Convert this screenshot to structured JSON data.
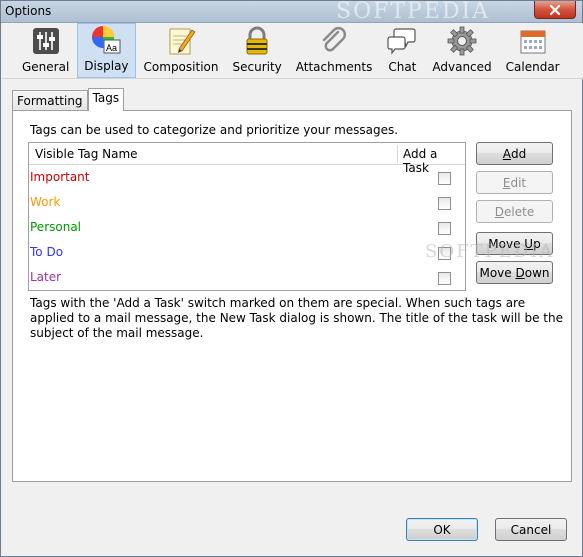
{
  "window": {
    "title": "Options",
    "watermark": "SOFTPEDIA"
  },
  "toolbar": {
    "items": [
      {
        "label": "General",
        "icon": "sliders-icon"
      },
      {
        "label": "Display",
        "icon": "color-wheel-icon"
      },
      {
        "label": "Composition",
        "icon": "notepad-pencil-icon"
      },
      {
        "label": "Security",
        "icon": "padlock-icon"
      },
      {
        "label": "Attachments",
        "icon": "paperclip-icon"
      },
      {
        "label": "Chat",
        "icon": "speech-bubbles-icon"
      },
      {
        "label": "Advanced",
        "icon": "gear-icon"
      },
      {
        "label": "Calendar",
        "icon": "calendar-icon"
      }
    ],
    "selected": "Display"
  },
  "tabs": [
    {
      "label": "Formatting",
      "active": false
    },
    {
      "label": "Tags",
      "active": true
    }
  ],
  "tags_panel": {
    "intro": "Tags can be used to categorize and prioritize your messages.",
    "columns": {
      "name": "Visible Tag Name",
      "task": "Add a Task"
    },
    "rows": [
      {
        "name": "Important",
        "color": "#cc0000",
        "checked": false
      },
      {
        "name": "Work",
        "color": "#ff9900",
        "checked": false
      },
      {
        "name": "Personal",
        "color": "#009900",
        "checked": false
      },
      {
        "name": "To Do",
        "color": "#3333ff",
        "checked": false
      },
      {
        "name": "Later",
        "color": "#993399",
        "checked": false
      }
    ],
    "buttons": {
      "add": {
        "pre": "",
        "u": "A",
        "post": "dd"
      },
      "edit": {
        "pre": "",
        "u": "E",
        "post": "dit"
      },
      "delete": {
        "pre": "",
        "u": "D",
        "post": "elete"
      },
      "move_up": {
        "pre": "Move ",
        "u": "U",
        "post": "p"
      },
      "move_down": {
        "pre": "Move ",
        "u": "D",
        "post": "own"
      }
    },
    "note": "Tags with the 'Add a Task' switch marked on them are special. When such tags are applied to a mail message, the New Task dialog is shown. The title of the task will be the subject of the mail message."
  },
  "footer": {
    "ok": "OK",
    "cancel": "Cancel"
  },
  "colors": {
    "selected_tool_bg": "#cfe0f3",
    "title_bar": "#b9c9da",
    "close_button": "#c94a36"
  }
}
